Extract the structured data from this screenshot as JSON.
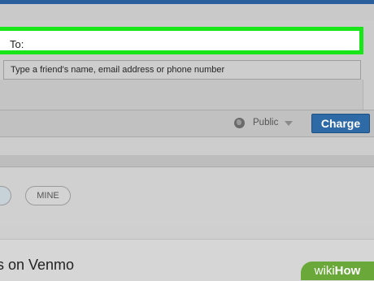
{
  "compose": {
    "to_label": "To:",
    "recipient_hint": "Type a friend's name, email address or phone number"
  },
  "actions": {
    "privacy_label": "Public",
    "charge_label": "Charge"
  },
  "filters": {
    "mine_label": "MINE"
  },
  "feed": {
    "title": "s on Venmo"
  },
  "watermark": {
    "prefix": "wiki",
    "suffix": "How"
  },
  "colors": {
    "highlight": "#19e619",
    "charge_button": "#2d6aa6",
    "top_bar": "#2a5f9e"
  }
}
